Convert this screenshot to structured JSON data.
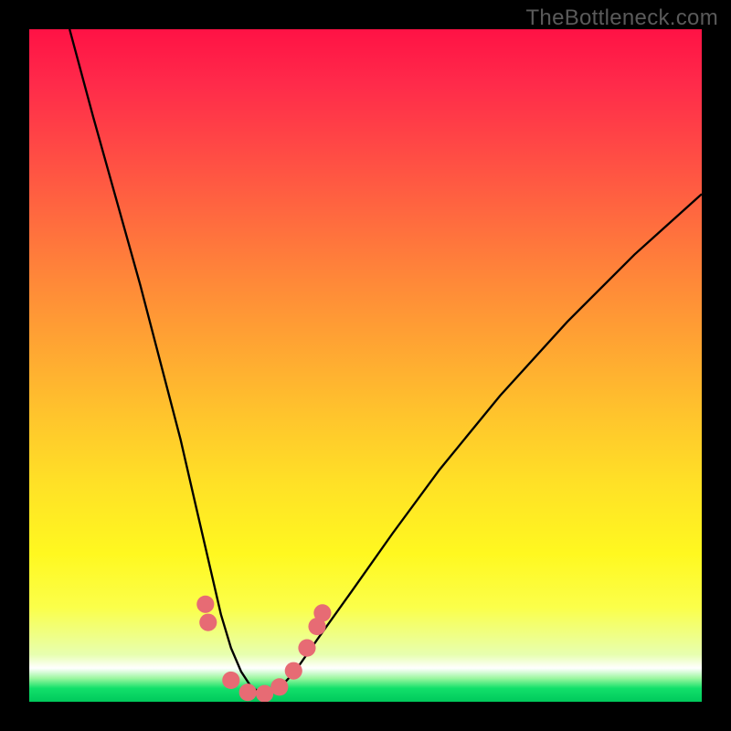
{
  "watermark": "TheBottleneck.com",
  "chart_data": {
    "type": "line",
    "title": "",
    "xlabel": "",
    "ylabel": "",
    "xlim": [
      0,
      1000
    ],
    "ylim": [
      0,
      1000
    ],
    "series": [
      {
        "name": "bottleneck-curve",
        "x": [
          60,
          95,
          130,
          165,
          195,
          225,
          248,
          270,
          285,
          300,
          315,
          330,
          350,
          370,
          395,
          430,
          480,
          540,
          610,
          700,
          800,
          900,
          1000
        ],
        "values": [
          1000,
          870,
          745,
          620,
          505,
          390,
          290,
          195,
          130,
          80,
          45,
          22,
          10,
          18,
          45,
          95,
          165,
          250,
          345,
          455,
          565,
          665,
          755
        ]
      }
    ],
    "markers": {
      "name": "curve-markers",
      "color": "#e76b74",
      "points": [
        {
          "x": 262,
          "y": 145
        },
        {
          "x": 266,
          "y": 118
        },
        {
          "x": 300,
          "y": 32
        },
        {
          "x": 325,
          "y": 14
        },
        {
          "x": 350,
          "y": 12
        },
        {
          "x": 372,
          "y": 22
        },
        {
          "x": 393,
          "y": 46
        },
        {
          "x": 413,
          "y": 80
        },
        {
          "x": 428,
          "y": 112
        },
        {
          "x": 436,
          "y": 132
        }
      ]
    }
  }
}
